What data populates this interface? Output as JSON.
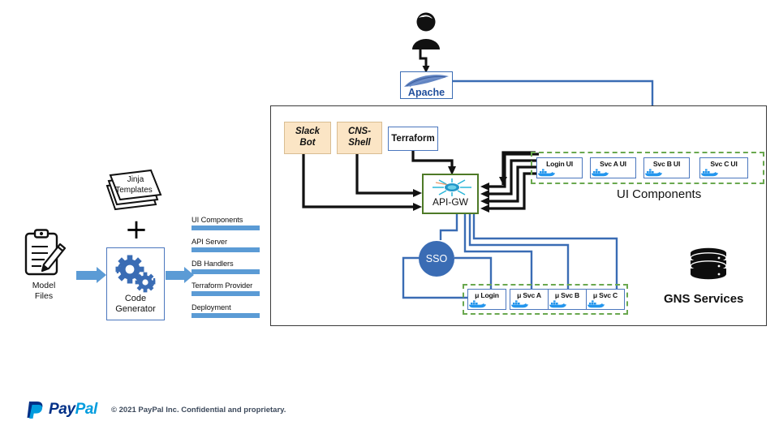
{
  "page": {
    "background": "#ffffff",
    "accent_blue": "#5b9bd5",
    "line_blue": "#3a6cb4",
    "line_black": "#000000",
    "dashed_green": "#6aa84f",
    "cream": "#fbe5c5",
    "gateway_green": "#4e7a27"
  },
  "generator": {
    "model_files": {
      "label": "Model\nFiles",
      "icon": "clipboard-pencil-icon"
    },
    "jinja": {
      "label": "Jinja\nTemplates",
      "icon": "stacked-pages-icon"
    },
    "plus": "+",
    "code_generator": {
      "label": "Code\nGenerator",
      "icon": "gears-icon"
    },
    "outputs": [
      {
        "label": "UI Components"
      },
      {
        "label": "API Server"
      },
      {
        "label": "DB Handlers"
      },
      {
        "label": "Terraform Provider"
      },
      {
        "label": "Deployment"
      }
    ]
  },
  "actor": {
    "icon": "user-person-icon"
  },
  "apache": {
    "label": "Apache",
    "icon": "apache-feather-icon"
  },
  "architecture": {
    "clients": [
      {
        "label": "Slack\nBot",
        "style": "cream"
      },
      {
        "label": "CNS-\nShell",
        "style": "cream"
      },
      {
        "label": "Terraform",
        "style": "white"
      }
    ],
    "gateway": {
      "label": "API-GW",
      "icon": "kong-starburst-icon"
    },
    "sso": {
      "label": "SSO"
    },
    "ui_components": {
      "caption": "UI Components",
      "items": [
        {
          "label": "Login UI",
          "icon": "docker-whale-icon"
        },
        {
          "label": "Svc A UI",
          "icon": "docker-whale-icon"
        },
        {
          "label": "Svc B UI",
          "icon": "docker-whale-icon"
        },
        {
          "label": "Svc C UI",
          "icon": "docker-whale-icon"
        }
      ]
    },
    "microservices": {
      "items": [
        {
          "label": "μ Login",
          "icon": "docker-whale-icon"
        },
        {
          "label": "μ Svc A",
          "icon": "docker-whale-icon"
        },
        {
          "label": "μ Svc B",
          "icon": "docker-whale-icon"
        },
        {
          "label": "μ Svc C",
          "icon": "docker-whale-icon"
        }
      ]
    },
    "gns": {
      "caption": "GNS Services",
      "icon": "database-cylinder-icon"
    }
  },
  "footer": {
    "brand": {
      "first": "Pay",
      "second": "Pal",
      "icon": "paypal-logo-icon"
    },
    "copyright": "© 2021 PayPal Inc. Confidential and proprietary."
  }
}
